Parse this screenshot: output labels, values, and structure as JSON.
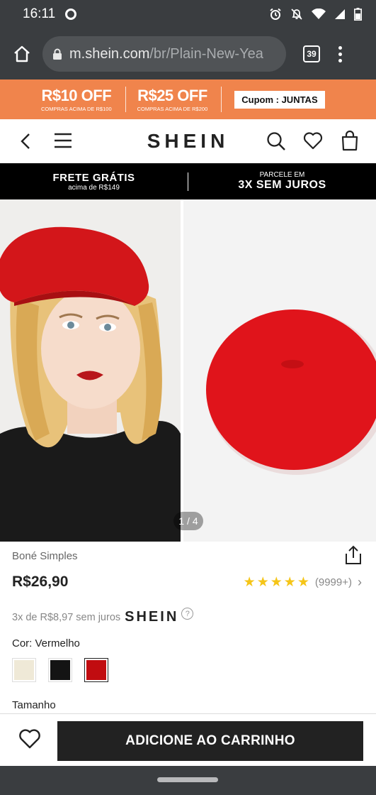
{
  "status_bar": {
    "time": "16:11"
  },
  "browser": {
    "url_host": "m.shein.com",
    "url_path": "/br/Plain-New-Yea",
    "tab_count": "39"
  },
  "promo": {
    "offer1_big": "R$10 OFF",
    "offer1_small": "COMPRAS ACIMA DE  R$100",
    "offer2_big": "R$25 OFF",
    "offer2_small": "COMPRAS ACIMA DE  R$200",
    "coupon": "Cupom : JUNTAS"
  },
  "header": {
    "logo": "SHEIN"
  },
  "shipping": {
    "left_title": "FRETE GRÁTIS",
    "left_sub": "acima de R$149",
    "right_sub": "PARCELE EM",
    "right_title": "3X SEM JUROS"
  },
  "gallery": {
    "counter": "1 / 4"
  },
  "product": {
    "name": "Boné Simples",
    "price": "R$26,90",
    "rating_count": "(9999+)",
    "rating_stars": 5,
    "installments": "3x de R$8,97 sem juros",
    "installment_brand": "SHEIN",
    "color_label": "Cor: Vermelho",
    "swatches": [
      {
        "name": "Bege",
        "color": "#efe9d7"
      },
      {
        "name": "Preto",
        "color": "#141414"
      },
      {
        "name": "Vermelho",
        "color": "#c10c10",
        "selected": true
      }
    ],
    "size_label": "Tamanho"
  },
  "actions": {
    "add_to_cart": "ADICIONE AO CARRINHO"
  }
}
